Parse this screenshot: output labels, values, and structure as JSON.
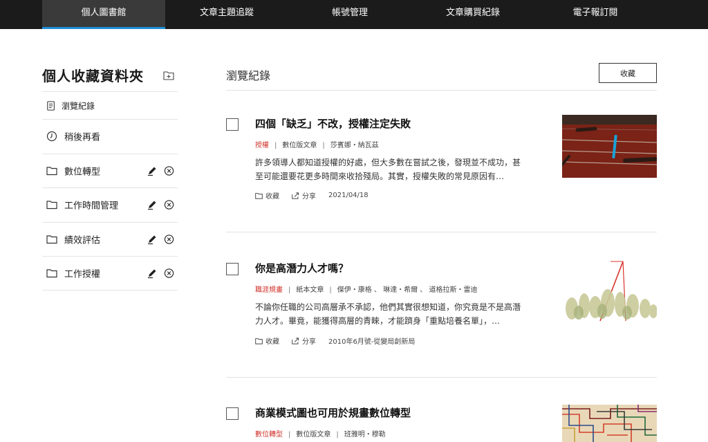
{
  "nav": {
    "items": [
      {
        "label": "個人圖書館",
        "active": true
      },
      {
        "label": "文章主題追蹤",
        "active": false
      },
      {
        "label": "帳號管理",
        "active": false
      },
      {
        "label": "文章購買紀錄",
        "active": false
      },
      {
        "label": "電子報訂閱",
        "active": false
      }
    ]
  },
  "sidebar": {
    "title": "個人收藏資料夾",
    "items": [
      {
        "label": "瀏覽紀錄",
        "icon": "document-icon"
      },
      {
        "label": "稍後再看",
        "icon": "clock-icon"
      },
      {
        "label": "數位轉型",
        "icon": "folder-icon"
      },
      {
        "label": "工作時間管理",
        "icon": "folder-icon"
      },
      {
        "label": "績效評估",
        "icon": "folder-icon"
      },
      {
        "label": "工作授權",
        "icon": "folder-icon"
      }
    ]
  },
  "main": {
    "title": "瀏覽紀錄",
    "collect_button": "收藏"
  },
  "articles": [
    {
      "title": "四個「缺乏」不改，授權注定失敗",
      "tag": "授權",
      "type": "數位版文章",
      "authors": "莎賓娜・納瓦茲",
      "summary": "許多領導人都知道授權的好處，但大多數在嘗試之後，發現並不成功，甚至可能還要花更多時間來收拾殘局。其實，授權失敗的常見原因有…",
      "collect_label": "收藏",
      "share_label": "分享",
      "date": "2021/04/18"
    },
    {
      "title": "你是高潛力人才嗎？",
      "tag": "職涯規畫",
      "type": "紙本文章",
      "authors": "傑伊・康格 、 琳達・希爾 、 道格拉斯・雷迪",
      "summary": "不論你任職的公司高層承不承認，他們其實很想知道，你究竟是不是高潛力人才。畢竟，能獲得高層的青睞，才能躋身「重點培養名單」，…",
      "collect_label": "收藏",
      "share_label": "分享",
      "date": "2010年6月號-從變局創新局"
    },
    {
      "title": "商業模式圖也可用於規畫數位轉型",
      "tag": "數位轉型",
      "type": "數位版文章",
      "authors": "班雅明・穆勒"
    }
  ],
  "colors": {
    "nav_bg": "#1b1b1b",
    "nav_active": "#3a3a3a",
    "nav_accent": "#1f8fd6",
    "tag_red": "#d0342c"
  }
}
